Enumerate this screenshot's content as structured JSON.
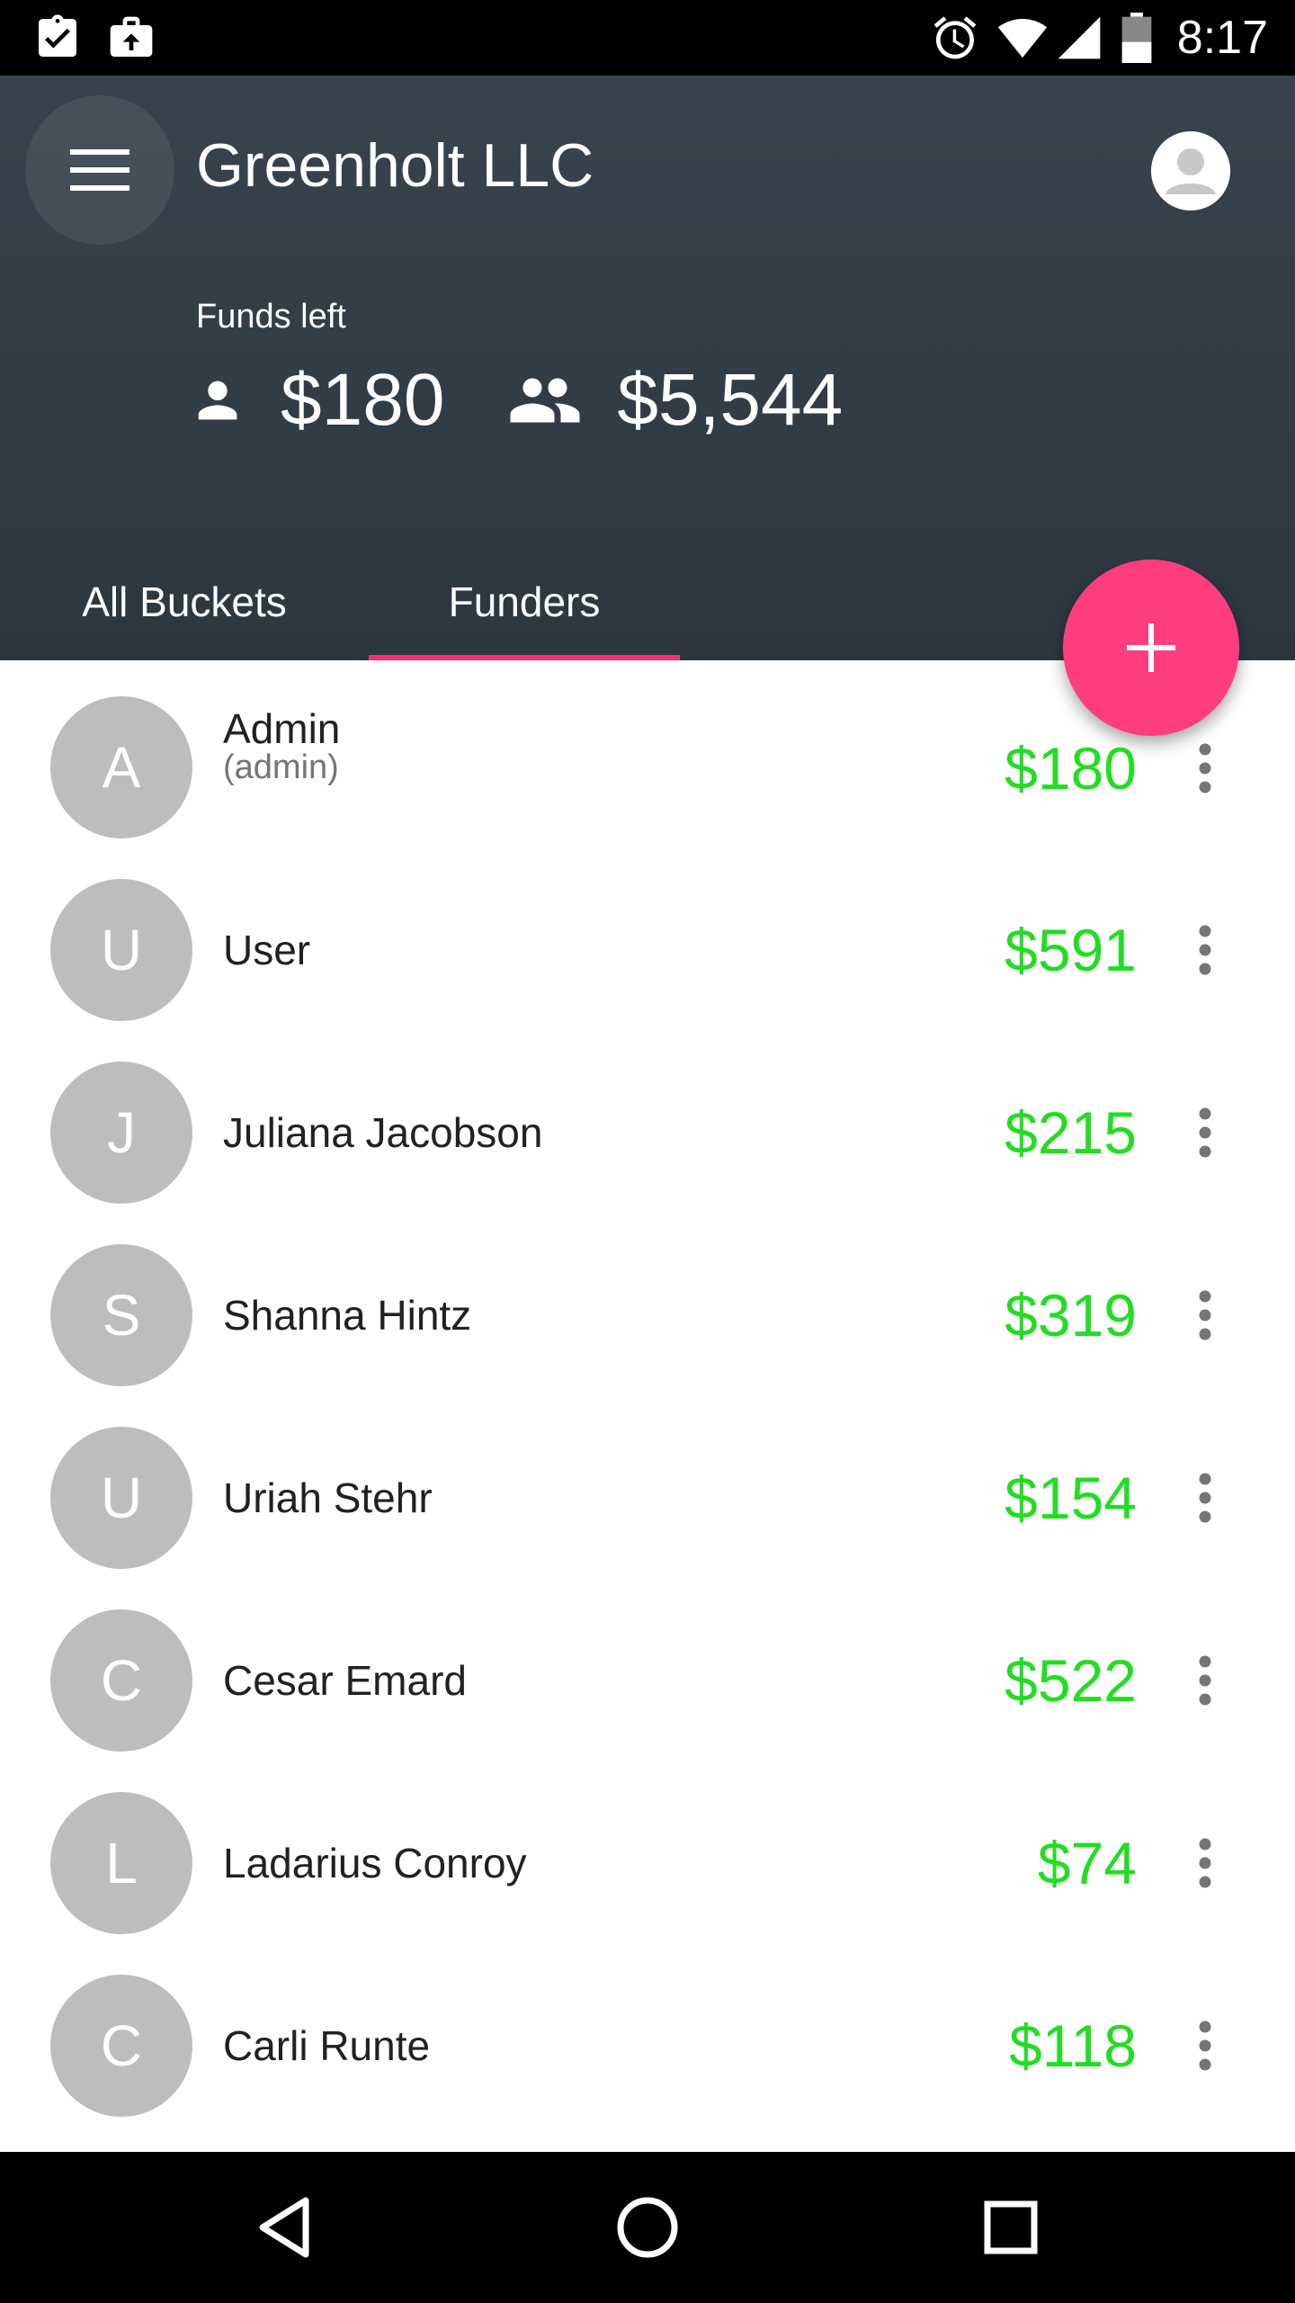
{
  "status_bar": {
    "time": "8:17",
    "icons": [
      "clipboard-check-icon",
      "briefcase-upload-icon",
      "alarm-icon",
      "wifi-icon",
      "cell-signal-icon",
      "battery-icon"
    ]
  },
  "header": {
    "title": "Greenholt LLC",
    "funds_label": "Funds left",
    "personal_funds": "$180",
    "group_funds": "$5,544"
  },
  "tabs": [
    {
      "label": "All Buckets",
      "active": false
    },
    {
      "label": "Funders",
      "active": true
    }
  ],
  "funders": [
    {
      "initial": "A",
      "name": "Admin",
      "role": "(admin)",
      "amount": "$180"
    },
    {
      "initial": "U",
      "name": "User",
      "role": "",
      "amount": "$591"
    },
    {
      "initial": "J",
      "name": "Juliana Jacobson",
      "role": "",
      "amount": "$215"
    },
    {
      "initial": "S",
      "name": "Shanna Hintz",
      "role": "",
      "amount": "$319"
    },
    {
      "initial": "U",
      "name": "Uriah Stehr",
      "role": "",
      "amount": "$154"
    },
    {
      "initial": "C",
      "name": "Cesar Emard",
      "role": "",
      "amount": "$522"
    },
    {
      "initial": "L",
      "name": "Ladarius Conroy",
      "role": "",
      "amount": "$74"
    },
    {
      "initial": "C",
      "name": "Carli Runte",
      "role": "",
      "amount": "$118"
    }
  ],
  "colors": {
    "header_bg": "#323d47",
    "accent": "#ff3d7f",
    "amount": "#22dd22",
    "avatar_bg": "#bdbdbd"
  }
}
